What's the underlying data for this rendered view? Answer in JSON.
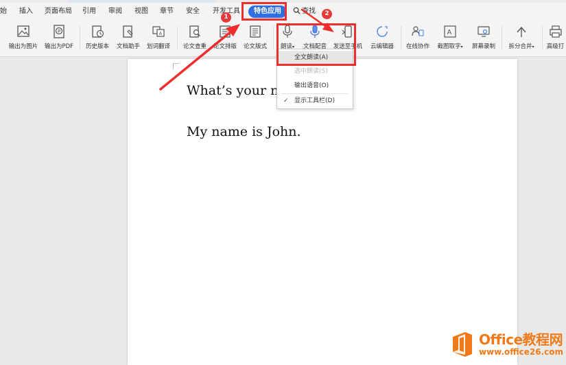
{
  "menu": {
    "items": [
      "始",
      "插入",
      "页面布局",
      "引用",
      "审阅",
      "视图",
      "章节",
      "安全",
      "开发工具"
    ],
    "active": "特色应用",
    "search": "查找"
  },
  "toolbar": {
    "buttons": [
      {
        "label": "输出为图片",
        "icon": "image-export-icon"
      },
      {
        "label": "输出为PDF",
        "icon": "pdf-export-icon"
      },
      {
        "label": "历史版本",
        "icon": "history-icon"
      },
      {
        "label": "文档助手",
        "icon": "doc-assistant-icon"
      },
      {
        "label": "划词翻译",
        "icon": "translate-icon"
      },
      {
        "label": "论文查重",
        "icon": "paper-check-icon"
      },
      {
        "label": "论文排版",
        "icon": "paper-layout-icon"
      },
      {
        "label": "论文版式",
        "icon": "paper-format-icon"
      },
      {
        "label": "朗读",
        "icon": "microphone-icon"
      },
      {
        "label": "文档配音",
        "icon": "voice-icon"
      },
      {
        "label": "发送至手机",
        "icon": "send-phone-icon"
      },
      {
        "label": "云编辑器",
        "icon": "cloud-edit-icon"
      },
      {
        "label": "在线协作",
        "icon": "collaboration-icon"
      },
      {
        "label": "截图取字",
        "icon": "ocr-icon"
      },
      {
        "label": "屏幕录制",
        "icon": "screen-record-icon"
      },
      {
        "label": "拆分合并",
        "icon": "split-merge-icon"
      },
      {
        "label": "高级打",
        "icon": "print-icon"
      }
    ]
  },
  "dropdown": {
    "items": [
      {
        "label": "全文朗读(A)",
        "state": "hover"
      },
      {
        "label": "选中朗读(S)",
        "state": "disabled"
      },
      {
        "label": "输出语音(O)",
        "state": "normal"
      },
      {
        "label": "显示工具栏(D)",
        "state": "checked"
      }
    ]
  },
  "document": {
    "lines": [
      "What’s your name?",
      "My name is John."
    ]
  },
  "annotations": {
    "step1": "1",
    "step2": "2",
    "highlight_color": "#ee2d2d"
  },
  "watermark": {
    "title": "Office教程网",
    "url": "www.office26.com"
  }
}
